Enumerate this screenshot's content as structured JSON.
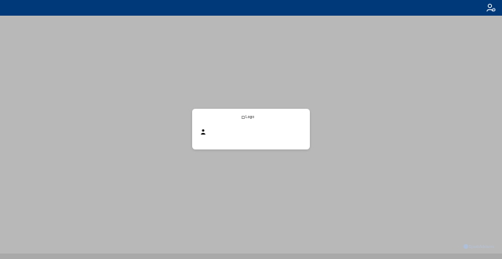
{
  "header": {
    "background_color": "#00397a",
    "user_icon": "user-settings-icon"
  },
  "login": {
    "logo_alt": "Logo",
    "username_icon": "user-icon",
    "username_value": "",
    "username_placeholder": ""
  },
  "overlay_color": "#b8b8b8",
  "watermark": {
    "text": "SparkAdvisors",
    "icon": "sparkadvisors-logo-icon"
  }
}
